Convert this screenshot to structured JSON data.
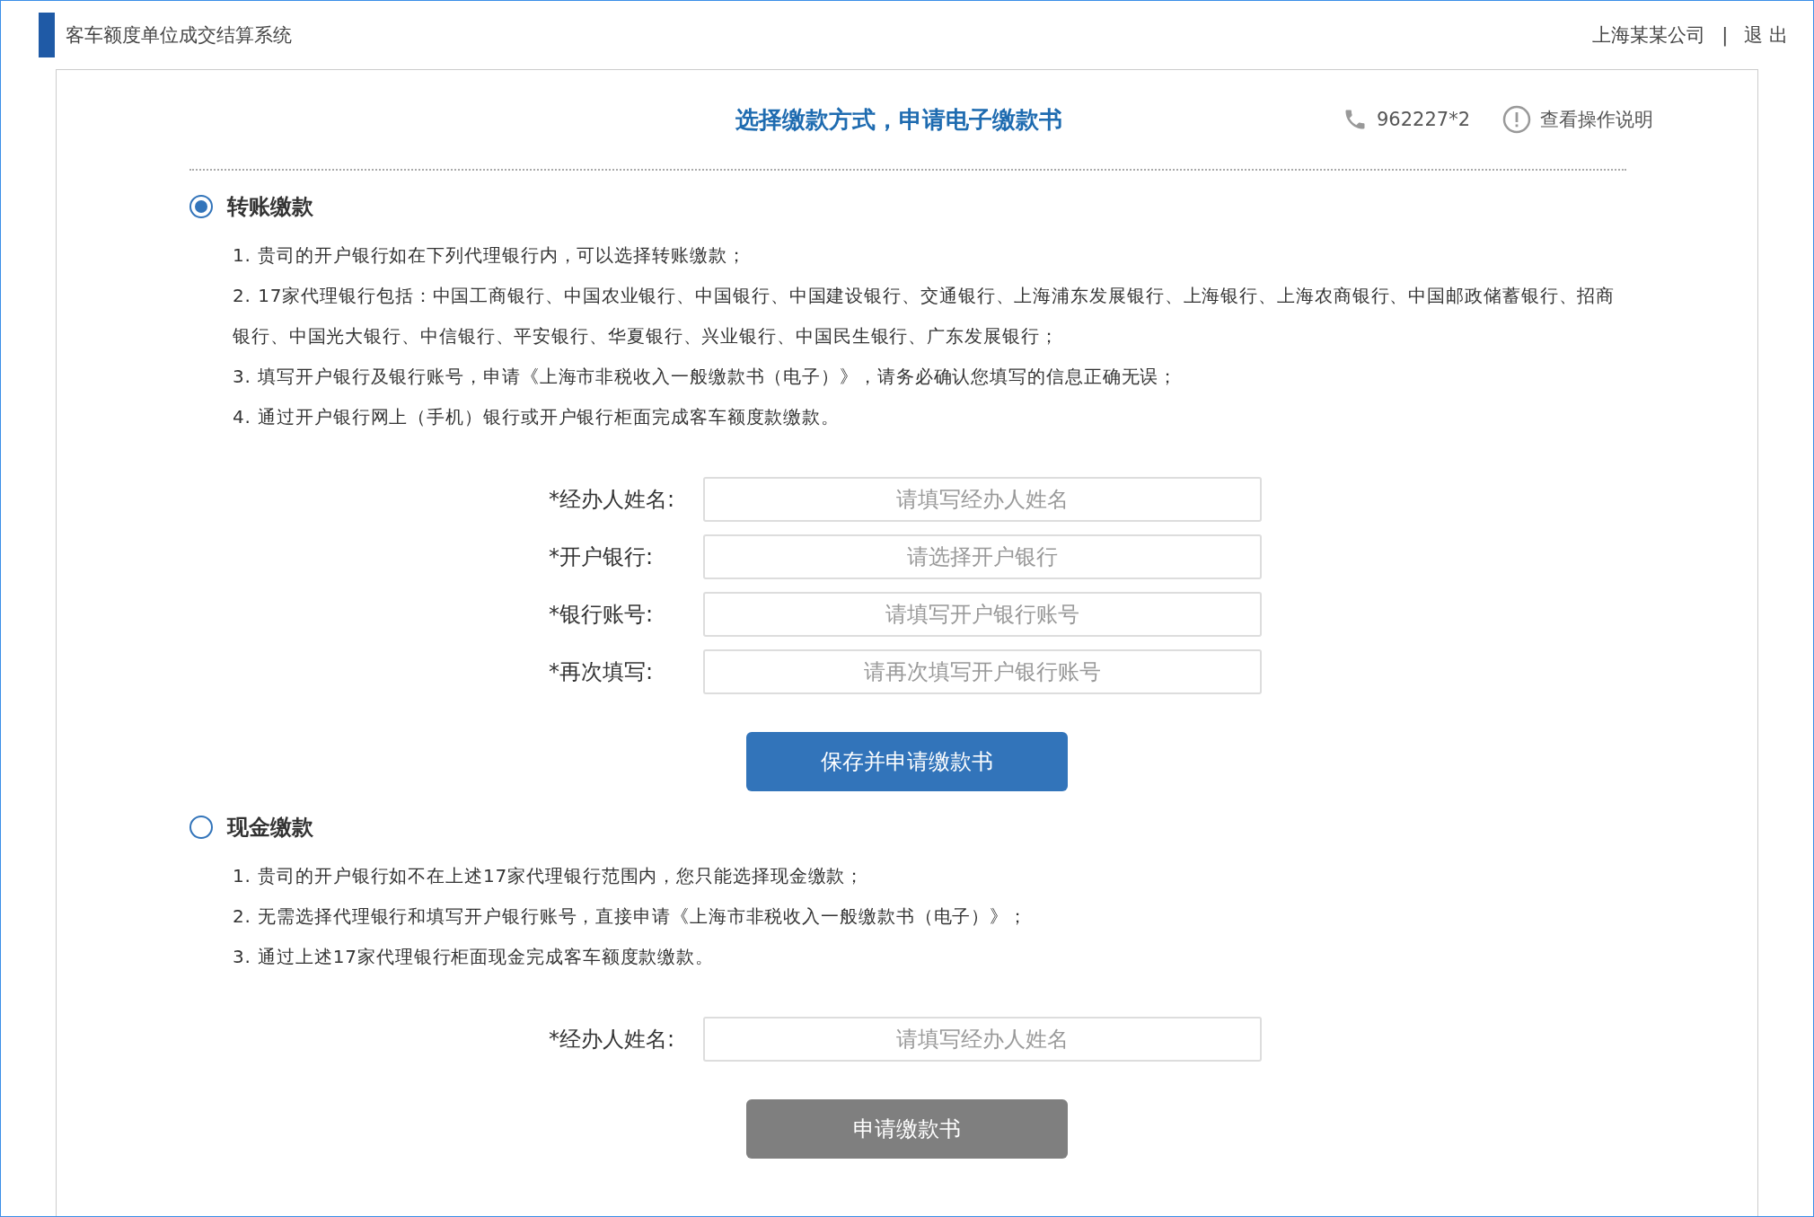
{
  "header": {
    "system_title": "客车额度单位成交结算系统",
    "company": "上海某某公司",
    "separator": "|",
    "logout": "退 出"
  },
  "page": {
    "title": "选择缴款方式，申请电子缴款书",
    "phone": "962227*2",
    "help_link": "查看操作说明"
  },
  "payment_methods": [
    {
      "label": "转账缴款",
      "selected": true,
      "notes": [
        "1. 贵司的开户银行如在下列代理银行内，可以选择转账缴款；",
        "2. 17家代理银行包括：中国工商银行、中国农业银行、中国银行、中国建设银行、交通银行、上海浦东发展银行、上海银行、上海农商银行、中国邮政储蓄银行、招商银行、中国光大银行、中信银行、平安银行、华夏银行、兴业银行、中国民生银行、广东发展银行；",
        "3. 填写开户银行及银行账号，申请《上海市非税收入一般缴款书（电子）》，请务必确认您填写的信息正确无误；",
        "4. 通过开户银行网上（手机）银行或开户银行柜面完成客车额度款缴款。"
      ],
      "fields": [
        {
          "label": "*经办人姓名:",
          "placeholder": "请填写经办人姓名"
        },
        {
          "label": "*开户银行:",
          "placeholder": "请选择开户银行"
        },
        {
          "label": "*银行账号:",
          "placeholder": "请填写开户银行账号"
        },
        {
          "label": "*再次填写:",
          "placeholder": "请再次填写开户银行账号"
        }
      ],
      "button": {
        "label": "保存并申请缴款书",
        "disabled": false
      }
    },
    {
      "label": "现金缴款",
      "selected": false,
      "notes": [
        "1. 贵司的开户银行如不在上述17家代理银行范围内，您只能选择现金缴款；",
        "2. 无需选择代理银行和填写开户银行账号，直接申请《上海市非税收入一般缴款书（电子）》；",
        "3. 通过上述17家代理银行柜面现金完成客车额度款缴款。"
      ],
      "fields": [
        {
          "label": "*经办人姓名:",
          "placeholder": "请填写经办人姓名"
        }
      ],
      "button": {
        "label": "申请缴款书",
        "disabled": true
      }
    }
  ]
}
